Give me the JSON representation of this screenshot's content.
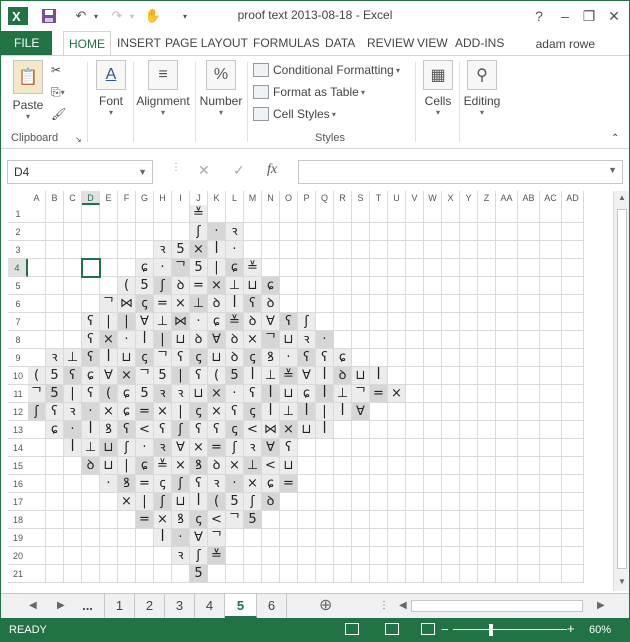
{
  "titlebar": {
    "title": "proof text 2013-08-18 - Excel",
    "excel_icon": "excel-logo-icon",
    "minimize": "–",
    "restore": "❐",
    "close": "✕",
    "help": "?"
  },
  "ribbon_tabs": [
    "FILE",
    "HOME",
    "INSERT",
    "PAGE LAYOUT",
    "FORMULAS",
    "DATA",
    "REVIEW",
    "VIEW",
    "ADD-INS"
  ],
  "active_tab": "HOME",
  "user": "adam rowe",
  "ribbon": {
    "paste": "Paste",
    "clipboard": "Clipboard",
    "font": "Font",
    "alignment": "Alignment",
    "number": "Number",
    "number_icon": "%",
    "conditional_formatting": "Conditional Formatting",
    "format_as_table": "Format as Table",
    "cell_styles": "Cell Styles",
    "styles": "Styles",
    "cells": "Cells",
    "editing": "Editing"
  },
  "formula_bar": {
    "name_box": "D4",
    "fx": "fx",
    "cancel": "✕",
    "enter": "✓",
    "formula": ""
  },
  "columns": [
    "A",
    "B",
    "C",
    "D",
    "E",
    "F",
    "G",
    "H",
    "I",
    "J",
    "K",
    "L",
    "M",
    "N",
    "O",
    "P",
    "Q",
    "R",
    "S",
    "T",
    "U",
    "V",
    "W",
    "X",
    "Y",
    "Z",
    "AA",
    "AB",
    "AC",
    "AD"
  ],
  "rows": [
    "1",
    "2",
    "3",
    "4",
    "5",
    "6",
    "7",
    "8",
    "9",
    "10",
    "11",
    "12",
    "13",
    "14",
    "15",
    "16",
    "17",
    "18",
    "19",
    "20",
    "21"
  ],
  "selected_cell": {
    "col": "D",
    "row": "4"
  },
  "cell_text": {
    "1": {
      "J": "≚"
    },
    "2": {
      "J": "ʃ",
      "K": "·",
      "L": "ꝛ"
    },
    "3": {
      "H": "ꝛ",
      "I": "5",
      "J": "×",
      "K": "ꟾ",
      "L": "·"
    },
    "4": {
      "G": "ɕ",
      "H": "·",
      "I": "ᄀ",
      "J": "5",
      "K": "|",
      "L": "ɕ",
      "M": "≚"
    },
    "5": {
      "F": "(",
      "G": "5",
      "H": "ʃ",
      "I": "ꝺ",
      "J": "=",
      "K": "×",
      "L": "⊥",
      "M": "⊔",
      "N": "ɕ"
    },
    "6": {
      "E": "ᄀ",
      "F": "⋈",
      "G": "ꞔ",
      "H": "=",
      "I": "×",
      "J": "⊥",
      "K": "ꝺ",
      "L": "ꟾ",
      "M": "ʕ",
      "N": "ꝺ"
    },
    "7": {
      "D": "ʕ",
      "E": "|",
      "F": "|",
      "G": "∀",
      "H": "⊥",
      "I": "⋈",
      "J": "·",
      "K": "ɕ",
      "L": "≚",
      "M": "ꝺ",
      "N": "∀",
      "O": "ʕ",
      "P": "ʃ"
    },
    "8": {
      "D": "ʕ",
      "E": "×",
      "F": "·",
      "G": "ꟾ",
      "H": "|",
      "I": "⊔",
      "J": "ꝺ",
      "K": "∀",
      "L": "ꝺ",
      "M": "×",
      "N": "ᄀ",
      "O": "⊔",
      "P": "ꝛ",
      "Q": "·"
    },
    "9": {
      "B": "ꝛ",
      "C": "⊥",
      "D": "ʕ",
      "E": "ꟾ",
      "F": "⊔",
      "G": "ꞔ",
      "H": "ᄀ",
      "I": "ʕ",
      "J": "ꞔ",
      "K": "⊔",
      "L": "ꝺ",
      "M": "ꞔ",
      "N": "ꝸ",
      "O": "·",
      "P": "ʕ",
      "Q": "ʕ",
      "R": "ɕ"
    },
    "10": {
      "A": "(",
      "B": "5",
      "C": "ʕ",
      "D": "ɕ",
      "E": "∀",
      "F": "×",
      "G": "ᄀ",
      "H": "5",
      "I": "|",
      "J": "ʕ",
      "K": "(",
      "L": "5",
      "M": "ꟾ",
      "N": "⊥",
      "O": "≚",
      "P": "∀",
      "Q": "ꟾ",
      "R": "ꝺ",
      "S": "⊔",
      "T": "ꟾ"
    },
    "11": {
      "A": "ᄀ",
      "B": "5",
      "C": "|",
      "D": "ʕ",
      "E": "(",
      "F": "ɕ",
      "G": "5",
      "H": "ꝛ",
      "I": "ꝛ",
      "J": "⊔",
      "K": "×",
      "L": "·",
      "M": "ʕ",
      "N": "ꟾ",
      "O": "⊔",
      "P": "ɕ",
      "Q": "ꟾ",
      "R": "⊥",
      "S": "ᄀ",
      "T": "=",
      "U": "×"
    },
    "12": {
      "A": "ʃ",
      "B": "ʕ",
      "C": "ꝛ",
      "D": "·",
      "E": "×",
      "F": "ɕ",
      "G": "=",
      "H": "×",
      "I": "|",
      "J": "ꞔ",
      "K": "×",
      "L": "ʕ",
      "M": "ꞔ",
      "N": "ꟾ",
      "O": "⊥",
      "P": "ꟾ",
      "Q": "|",
      "R": "ꟾ",
      "S": "∀"
    },
    "13": {
      "B": "ɕ",
      "C": "·",
      "D": "ꟾ",
      "E": "ꝸ",
      "F": "ʕ",
      "G": "<",
      "H": "ʕ",
      "I": "ʃ",
      "J": "ʕ",
      "K": "ʕ",
      "L": "ꞔ",
      "M": "<",
      "N": "⋈",
      "O": "×",
      "P": "⊔",
      "Q": "ꟾ"
    },
    "14": {
      "C": "ꟾ",
      "D": "⊥",
      "E": "⊔",
      "F": "ʃ",
      "G": "·",
      "H": "ꝛ",
      "I": "∀",
      "J": "×",
      "K": "=",
      "L": "ʃ",
      "M": "ꝛ",
      "N": "∀",
      "O": "ʕ"
    },
    "15": {
      "D": "ꝺ",
      "E": "⊔",
      "F": "|",
      "G": "ɕ",
      "H": "≚",
      "I": "×",
      "J": "ꝸ",
      "K": "ꝺ",
      "L": "×",
      "M": "⊥",
      "N": "<",
      "O": "⊔"
    },
    "16": {
      "E": "·",
      "F": "ꝸ",
      "G": "=",
      "H": "ꞔ",
      "I": "ʃ",
      "J": "ʕ",
      "K": "ꝛ",
      "L": "·",
      "M": "×",
      "N": "ɕ",
      "O": "="
    },
    "17": {
      "F": "×",
      "G": "|",
      "H": "ʃ",
      "I": "⊔",
      "J": "ꟾ",
      "K": "(",
      "L": "5",
      "M": "ʃ",
      "N": "ꝺ"
    },
    "18": {
      "G": "=",
      "H": "×",
      "I": "ꝸ",
      "J": "ꞔ",
      "K": "<",
      "L": "ᄀ",
      "M": "5"
    },
    "19": {
      "H": "ꟾ",
      "I": "·",
      "J": "∀",
      "K": "ᄀ"
    },
    "20": {
      "I": "ꝛ",
      "J": "ʃ",
      "K": "≚"
    },
    "21": {
      "J": "5"
    }
  },
  "sheet_tabs": [
    "...",
    "1",
    "2",
    "3",
    "4",
    "5",
    "6"
  ],
  "active_sheet": "5",
  "status": {
    "text": "READY",
    "zoom": "60%",
    "zoom_level_percent": 60
  }
}
